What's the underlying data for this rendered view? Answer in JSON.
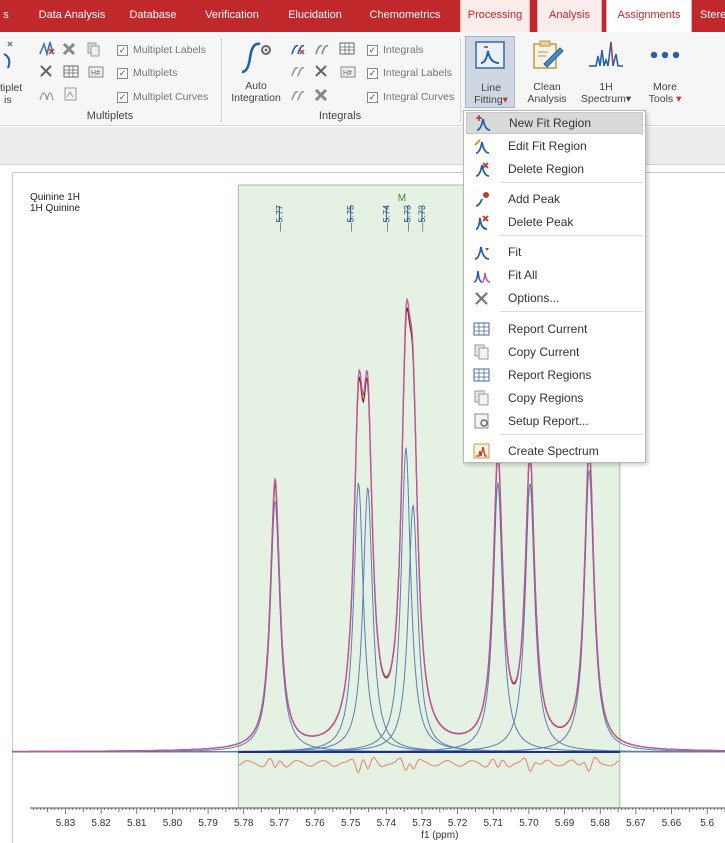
{
  "ribbon": {
    "tabs": [
      {
        "label": "s"
      },
      {
        "label": "Data Analysis"
      },
      {
        "label": "Database"
      },
      {
        "label": "Verification"
      },
      {
        "label": "Elucidation"
      },
      {
        "label": "Chemometrics"
      },
      {
        "label": "Processing"
      },
      {
        "label": "Analysis"
      },
      {
        "label": "Assignments"
      },
      {
        "label": "Stere"
      }
    ],
    "left_cut_label_1": "tiplet",
    "left_cut_label_2": "is",
    "multiplets": {
      "group_label": "Multiplets",
      "check_labels": "Multiplet Labels",
      "check_multiplets": "Multiplets",
      "check_curves": "Multiplet Curves"
    },
    "integrals": {
      "group_label": "Integrals",
      "auto_line1": "Auto",
      "auto_line2": "Integration",
      "check_integrals": "Integrals",
      "check_labels": "Integral Labels",
      "check_curves": "Integral Curves"
    },
    "line_fitting_line1": "Line",
    "line_fitting_line2": "Fitting",
    "clean_line1": "Clean",
    "clean_line2": "Analysis",
    "spectrum_line1": "1H",
    "spectrum_line2": "Spectrum",
    "more_line1": "More",
    "more_line2": "Tools"
  },
  "plot": {
    "title_line1": "Quinine 1H",
    "title_line2": "1H Quinine",
    "peak_marker": "M"
  },
  "menu": {
    "items": [
      {
        "label": "New Fit Region"
      },
      {
        "label": "Edit Fit Region"
      },
      {
        "label": "Delete Region"
      },
      {
        "label": "Add Peak"
      },
      {
        "label": "Delete Peak"
      },
      {
        "label": "Fit"
      },
      {
        "label": "Fit All"
      },
      {
        "label": "Options..."
      },
      {
        "label": "Report Current"
      },
      {
        "label": "Copy Current"
      },
      {
        "label": "Report Regions"
      },
      {
        "label": "Copy Regions"
      },
      {
        "label": "Setup Report..."
      },
      {
        "label": "Create Spectrum"
      }
    ]
  },
  "chart_data": {
    "type": "line",
    "xlabel": "f1 (ppm)",
    "x_reversed": true,
    "xlim": [
      5.845,
      5.645
    ],
    "ticks": [
      5.83,
      5.82,
      5.81,
      5.8,
      5.79,
      5.78,
      5.77,
      5.76,
      5.75,
      5.74,
      5.73,
      5.72,
      5.71,
      5.7,
      5.69,
      5.68,
      5.67,
      5.66,
      5.65
    ],
    "tick_labels": [
      "5.83",
      "5.82",
      "5.81",
      "5.80",
      "5.79",
      "5.78",
      "5.77",
      "5.76",
      "5.75",
      "5.74",
      "5.73",
      "5.72",
      "5.71",
      "5.70",
      "5.69",
      "5.68",
      "5.67",
      "5.66",
      "5.6"
    ],
    "fit_region_ppm": [
      5.7815,
      5.6745
    ],
    "peak_labels": [
      {
        "ppm": 5.77,
        "label": "5.77"
      },
      {
        "ppm": 5.75,
        "label": "5.75"
      },
      {
        "ppm": 5.74,
        "label": "5.74"
      },
      {
        "ppm": 5.734,
        "label": "5.73"
      },
      {
        "ppm": 5.73,
        "label": "5.73"
      }
    ],
    "peaks": [
      {
        "ppm": 5.7712,
        "height": 0.57
      },
      {
        "ppm": 5.7478,
        "height": 0.61
      },
      {
        "ppm": 5.7452,
        "height": 0.6
      },
      {
        "ppm": 5.7345,
        "height": 0.69
      },
      {
        "ppm": 5.7325,
        "height": 0.56
      },
      {
        "ppm": 5.7087,
        "height": 0.61
      },
      {
        "ppm": 5.6997,
        "height": 0.61
      },
      {
        "ppm": 5.6831,
        "height": 0.64
      }
    ],
    "colors": {
      "spectrum": "#8b1a1a",
      "fit_sum": "#c05aa0",
      "components": "#5b7fb0",
      "baseline": "#1d2f8a",
      "residual": "#e8826a",
      "region": "#e5f1e2",
      "region_border": "#9cc49a"
    }
  }
}
